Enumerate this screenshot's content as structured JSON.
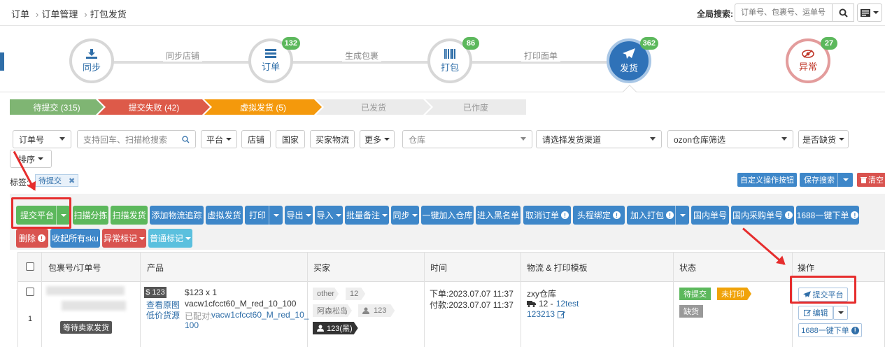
{
  "breadcrumb": [
    "订单",
    "订单管理",
    "打包发货"
  ],
  "global_search": {
    "label": "全局搜索:",
    "placeholder": "订单号、包裹号、运单号"
  },
  "flow": {
    "steps": [
      {
        "label": "同步",
        "badge": ""
      },
      {
        "label": "订单",
        "badge": "132"
      },
      {
        "label": "打包",
        "badge": "86"
      },
      {
        "label": "发货",
        "badge": "362"
      },
      {
        "label": "异常",
        "badge": "27"
      }
    ],
    "links": [
      "同步店铺",
      "生成包裹",
      "打印面单"
    ]
  },
  "status_tabs": [
    {
      "label": "待提交 (315)",
      "color": "#7fb573"
    },
    {
      "label": "提交失败 (42)",
      "color": "#dd5a49"
    },
    {
      "label": "虚拟发货 (5)",
      "color": "#f4990c"
    },
    {
      "label": "已发货",
      "color": "#ebebeb"
    },
    {
      "label": "已作废",
      "color": "#ebebeb"
    }
  ],
  "filters": {
    "order_no": "订单号",
    "scan_placeholder": "支持回车、扫描枪搜索",
    "platform": "平台",
    "shop": "店铺",
    "country": "国家",
    "buyer_logistics": "买家物流",
    "more": "更多",
    "warehouse": "仓库",
    "channel": "请选择发货渠道",
    "ozon": "ozon仓库筛选",
    "stockout": "是否缺货",
    "sort": "排序"
  },
  "tags": {
    "label": "标签:",
    "chip": "待提交",
    "chip_close": "✖"
  },
  "top_right_buttons": {
    "custom": "自定义操作按钮",
    "save_search": "保存搜索",
    "clear": "清空"
  },
  "actions": {
    "submit_platform": "提交平台",
    "scan_sort": "扫描分拣",
    "scan_ship": "扫描发货",
    "add_tracking": "添加物流追踪",
    "virtual_ship": "虚拟发货",
    "print": "打印",
    "export": "导出",
    "import": "导入",
    "batch_note": "批量备注",
    "sync": "同步",
    "add_warehouse": "一键加入仓库",
    "blacklist": "进入黑名单",
    "cancel_order": "取消订单",
    "head_bind": "头程绑定",
    "add_pack": "加入打包",
    "domestic_no": "国内单号",
    "domestic_purchase_no": "国内采购单号",
    "order_1688": "1688一键下单",
    "delete": "删除",
    "collapse_sku": "收起所有sku",
    "abnormal_mark": "异常标记",
    "normal_mark": "普通标记"
  },
  "table": {
    "headers": [
      "包裹号/订单号",
      "产品",
      "买家",
      "时间",
      "物流 & 打印模板",
      "状态",
      "操作"
    ],
    "row": {
      "index": "1",
      "waiting_label": "等待卖家发货",
      "price_badge": "$ 123",
      "view_image": "查看原图",
      "low_price": "低价货源",
      "qty": "$123 x 1",
      "sku": "vacw1cfcct60_M_red_10_100",
      "paired_label": "已配对:",
      "paired_sku": "vacw1cfcct60_M_red_10_",
      "paired_sku_tail": "100",
      "buyer_tag1": "other",
      "buyer_tag2": "12",
      "buyer_name": "阿森松岛",
      "buyer_num": "123",
      "buyer_black": "123(黑)",
      "order_time": "下单:2023.07.07 11:37",
      "pay_time": "付款:2023.07.07 11:37",
      "warehouse": "zxy仓库",
      "truck_num": "12 -",
      "logistic_link": "12test",
      "tracking": "123213",
      "status1": "待提交",
      "status2": "未打印",
      "status3": "缺货",
      "op_submit": "提交平台",
      "op_edit": "编辑",
      "op_1688": "1688一键下单"
    }
  }
}
